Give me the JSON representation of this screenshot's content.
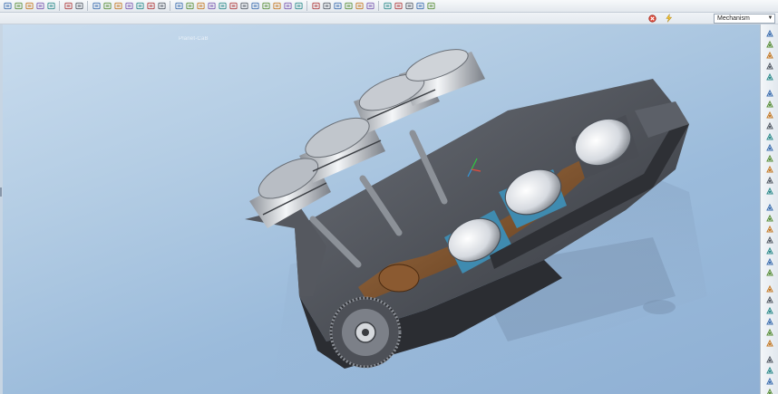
{
  "toolbar": {
    "buttons": [
      {
        "icon": "new-file-icon"
      },
      {
        "icon": "open-folder-icon"
      },
      {
        "icon": "save-icon"
      },
      {
        "icon": "print-icon"
      },
      {
        "icon": "email-icon"
      },
      {
        "icon": "undo-icon"
      },
      {
        "icon": "redo-icon"
      },
      {
        "icon": "cut-icon"
      },
      {
        "icon": "copy-icon"
      },
      {
        "icon": "paste-icon"
      },
      {
        "icon": "paste-special-icon"
      },
      {
        "icon": "regenerate-icon"
      },
      {
        "icon": "find-icon"
      },
      {
        "icon": "select-box-icon"
      },
      {
        "icon": "window-icon"
      },
      {
        "icon": "layer-icon"
      },
      {
        "icon": "model-tree-icon"
      },
      {
        "icon": "wireless-icon"
      },
      {
        "icon": "display-style-icon"
      },
      {
        "icon": "shading-icon"
      },
      {
        "icon": "repaint-icon"
      },
      {
        "icon": "zoom-in-icon"
      },
      {
        "icon": "zoom-out-icon"
      },
      {
        "icon": "refit-icon"
      },
      {
        "icon": "orient-icon"
      },
      {
        "icon": "saved-views-icon"
      },
      {
        "icon": "datum-plane-icon"
      },
      {
        "icon": "datum-axis-icon"
      },
      {
        "icon": "datum-point-icon"
      },
      {
        "icon": "csys-icon"
      },
      {
        "icon": "annotation-icon"
      },
      {
        "icon": "spin-center-icon"
      },
      {
        "icon": "sketch-icon"
      },
      {
        "icon": "plane-tool-icon"
      },
      {
        "icon": "axis-tool-icon"
      },
      {
        "icon": "point-tool-icon"
      },
      {
        "icon": "analysis-icon"
      }
    ]
  },
  "status": {
    "icons": [
      "stop-icon",
      "lightning-icon"
    ],
    "mode_label": "Mechanism"
  },
  "viewport": {
    "label": "Planet-CaB"
  },
  "right_toolbar": {
    "buttons": [
      "connect-icon",
      "drag-icon",
      "snapshot-icon",
      "cam-icon",
      "gear-pair-icon",
      "servo-motor-icon",
      "force-motor-icon",
      "spring-icon",
      "damper-icon",
      "force-torque-icon",
      "gravity-icon",
      "initial-condition-icon",
      "mass-property-icon",
      "analysis-run-icon",
      "playback-icon",
      "measure-icon",
      "trace-curve-icon",
      "joint-axis-icon",
      "body-icon",
      "slot-icon",
      "belt-icon",
      "3d-contact-icon",
      "bushing-icon",
      "load-icon",
      "curve-icon",
      "line-icon",
      "arc-icon",
      "point-icon",
      "delete-icon",
      "settings-icon",
      "results-icon",
      "report-icon"
    ]
  },
  "colors": {
    "viewport_top": "#c9dcee",
    "viewport_bottom": "#8fb0d4",
    "engine_block": "#4a4d54",
    "piston": "#c9cdd3",
    "crankshaft": "#7a4d2a",
    "cylinder_cutaway": "#3a8fb4"
  }
}
